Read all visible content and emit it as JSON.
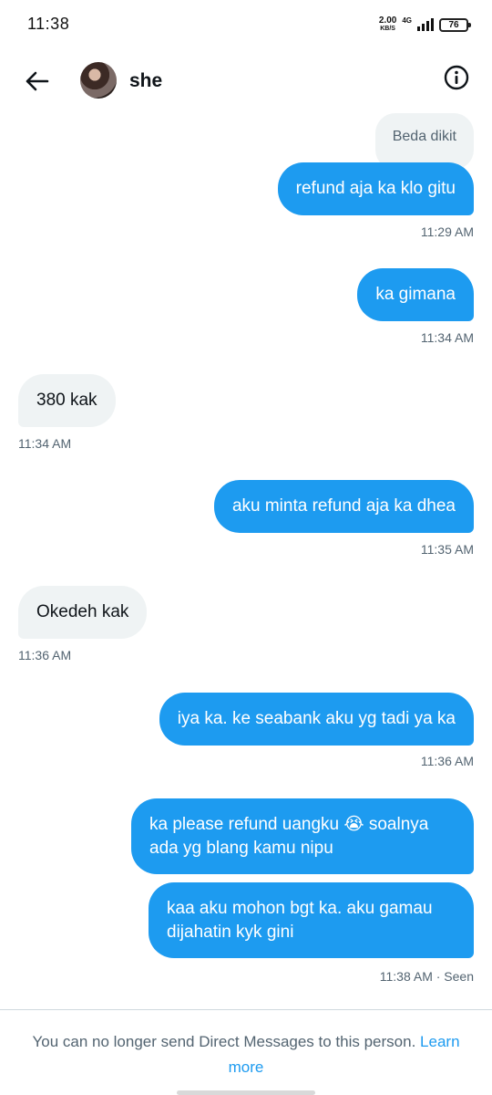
{
  "status_bar": {
    "time": "11:38",
    "net_speed": "2.00",
    "net_unit": "KB/S",
    "net_type": "4G",
    "battery": "76"
  },
  "header": {
    "name": "she"
  },
  "messages": [
    {
      "text": "Beda dikit",
      "kind": "quoted"
    },
    {
      "text": "refund aja ka klo gitu",
      "kind": "sent",
      "time": "11:29 AM"
    },
    {
      "text": "ka gimana",
      "kind": "sent",
      "time": "11:34 AM"
    },
    {
      "text": "380 kak",
      "kind": "received",
      "time": "11:34 AM"
    },
    {
      "text": "aku minta refund aja ka dhea",
      "kind": "sent",
      "time": "11:35 AM"
    },
    {
      "text": "Okedeh kak",
      "kind": "received",
      "time": "11:36 AM"
    },
    {
      "text": "iya ka. ke seabank aku yg tadi ya ka",
      "kind": "sent",
      "time": "11:36 AM"
    },
    {
      "text": "ka please refund uangku 😭 soalnya ada yg blang kamu nipu",
      "kind": "sent"
    },
    {
      "text": "kaa aku mohon bgt ka. aku gamau dijahatin kyk gini",
      "kind": "sent",
      "time": "11:38 AM · Seen"
    }
  ],
  "footer": {
    "notice": "You can no longer send Direct Messages to this person.",
    "link": "Learn more"
  },
  "colors": {
    "accent": "#1d9bf0",
    "received_bubble": "#eff3f4",
    "muted_text": "#536471"
  },
  "icons": {
    "back": "arrow-left-icon",
    "info": "info-circle-icon"
  }
}
